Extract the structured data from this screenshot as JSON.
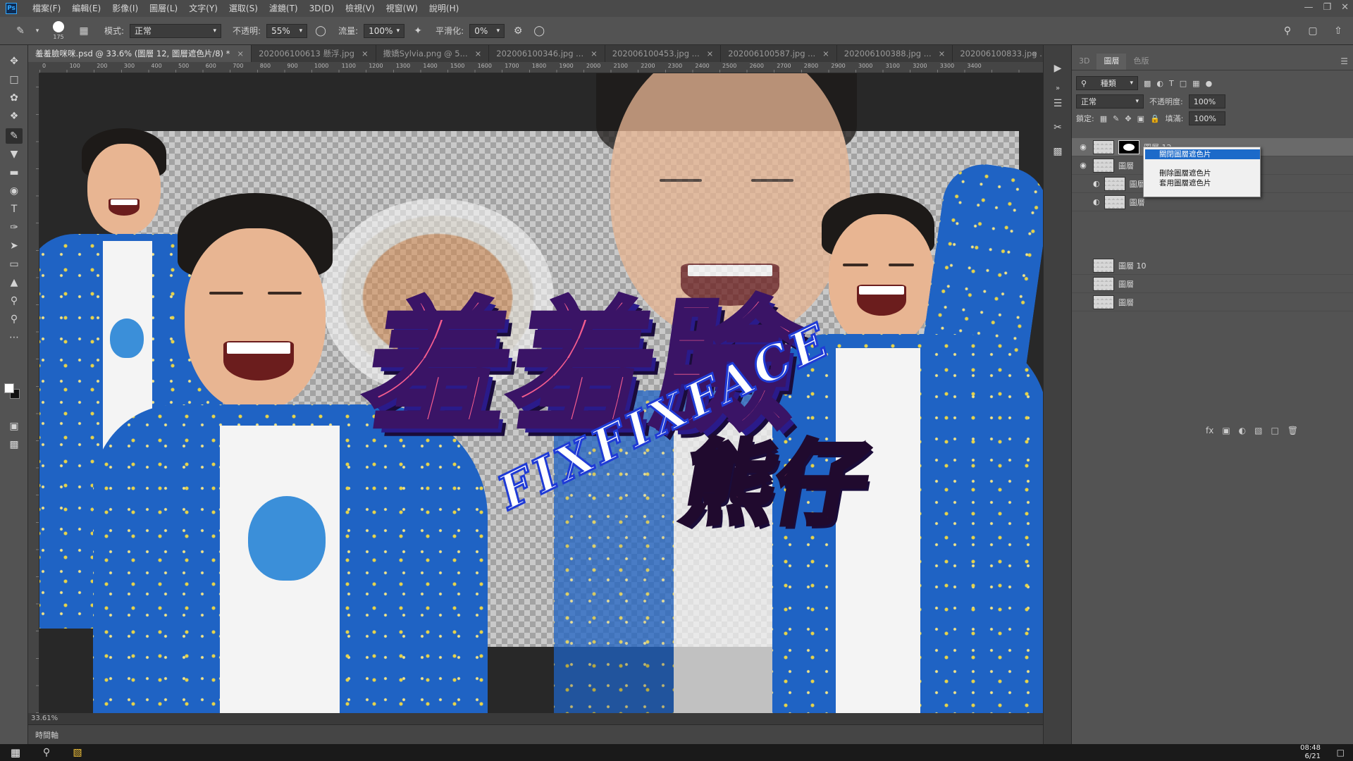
{
  "menubar": {
    "app_icon": "Ps",
    "items": [
      "檔案(F)",
      "編輯(E)",
      "影像(I)",
      "圖層(L)",
      "文字(Y)",
      "選取(S)",
      "濾鏡(T)",
      "3D(D)",
      "檢視(V)",
      "視窗(W)",
      "說明(H)"
    ]
  },
  "options": {
    "brush_size": "175",
    "mode_label": "模式:",
    "mode_value": "正常",
    "opacity_label": "不透明:",
    "opacity_value": "55%",
    "flow_label": "流量:",
    "flow_value": "100%",
    "smoothing_label": "平滑化:",
    "smoothing_value": "0%"
  },
  "tabs": [
    {
      "label": "羞羞臉咪咪.psd @ 33.6% (圖層 12, 圖層遮色片/8) *",
      "active": true
    },
    {
      "label": "202006100613 懸浮.jpg",
      "active": false
    },
    {
      "label": "撒嬌Sylvia.png @ 5...",
      "active": false
    },
    {
      "label": "202006100346.jpg ...",
      "active": false
    },
    {
      "label": "202006100453.jpg ...",
      "active": false
    },
    {
      "label": "202006100587.jpg ...",
      "active": false
    },
    {
      "label": "202006100388.jpg ...",
      "active": false
    },
    {
      "label": "202006100833.jpg ...",
      "active": false
    }
  ],
  "ruler": [
    "0",
    "100",
    "200",
    "300",
    "400",
    "500",
    "600",
    "700",
    "800",
    "900",
    "1000",
    "1100",
    "1200",
    "1300",
    "1400",
    "1500",
    "1600",
    "1700",
    "1800",
    "1900",
    "2000",
    "2100",
    "2200",
    "2300",
    "2400",
    "2500",
    "2600",
    "2700",
    "2800",
    "2900",
    "3000",
    "3100",
    "3200",
    "3300",
    "3400"
  ],
  "artwork": {
    "title_main": "羞羞臉",
    "title_sub": "熊仔",
    "title_en": "FIXFIXFACE"
  },
  "status": {
    "zoom": "33.61%"
  },
  "timeline_label": "時間軸",
  "panel": {
    "tabs": [
      "3D",
      "圖層",
      "色版"
    ],
    "kind_label": "種類",
    "blend": "正常",
    "opacity_label": "不透明度:",
    "opacity_value": "100%",
    "lock_label": "鎖定:",
    "fill_label": "填滿:",
    "fill_value": "100%",
    "layers": [
      {
        "name": "圖層 12",
        "selected": true
      },
      {
        "name": "圖層",
        "selected": false
      },
      {
        "name": "圖層",
        "selected": false
      },
      {
        "name": "圖層",
        "selected": false
      },
      {
        "name": "圖層 10",
        "selected": false
      },
      {
        "name": "圖層",
        "selected": false
      },
      {
        "name": "圖層",
        "selected": false
      }
    ]
  },
  "context_menu": {
    "items": [
      "關閉圖層遮色片",
      "刪除圖層遮色片",
      "套用圖層遮色片"
    ]
  },
  "taskbar": {
    "time": "08:48",
    "date": "6/21"
  }
}
